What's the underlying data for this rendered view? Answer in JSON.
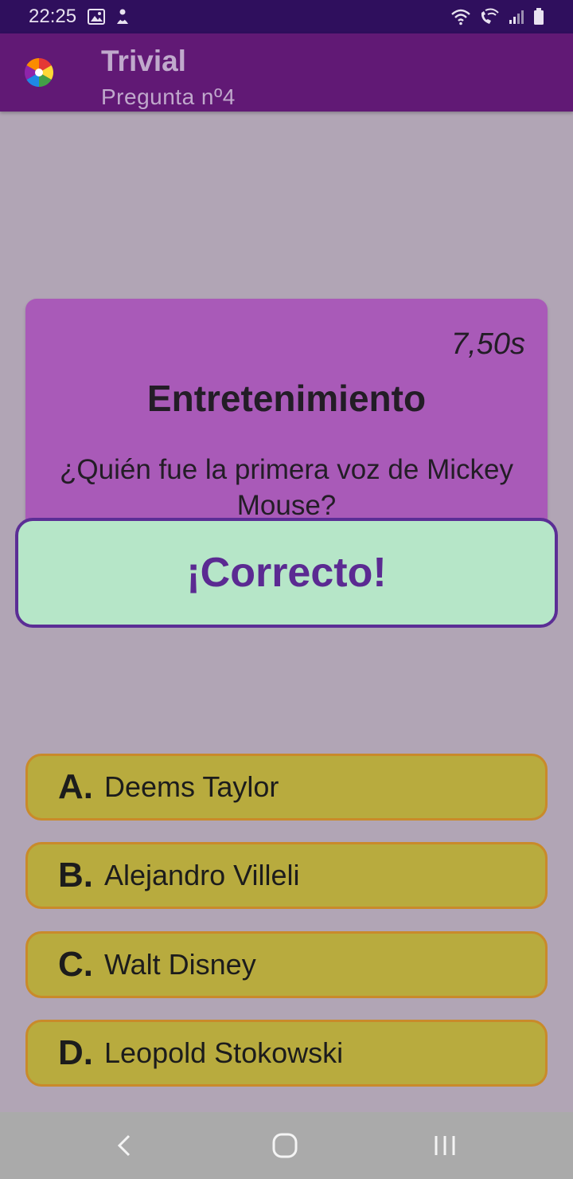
{
  "status_bar": {
    "time": "22:25",
    "left_icons": [
      "image-icon",
      "notification-icon"
    ],
    "right_icons": [
      "wifi-icon",
      "wifi-call-icon",
      "signal-icon",
      "battery-icon"
    ]
  },
  "app_bar": {
    "title": "Trivial",
    "subtitle": "Pregunta nº4",
    "logo_colors": [
      "#e53935",
      "#fdd835",
      "#43a047",
      "#1e88e5",
      "#8e24aa",
      "#fb8c00"
    ]
  },
  "question_card": {
    "timer": "7,50s",
    "category": "Entretenimiento",
    "question": "¿Quién fue la primera voz de Mickey Mouse?"
  },
  "feedback": {
    "text": "¡Correcto!"
  },
  "answers": [
    {
      "letter": "A.",
      "text": "Deems Taylor"
    },
    {
      "letter": "B.",
      "text": "Alejandro Villeli"
    },
    {
      "letter": "C.",
      "text": "Walt Disney"
    },
    {
      "letter": "D.",
      "text": "Leopold Stokowski"
    }
  ],
  "nav_bar": {
    "buttons": [
      "back-icon",
      "home-icon",
      "recents-icon"
    ]
  },
  "colors": {
    "status_bar": "#2f0f5d",
    "app_bar": "#611975",
    "background": "#b1a5b5",
    "card": "#a95ab8",
    "feedback_bg": "#b6e6c8",
    "feedback_border": "#5b2e95",
    "answer_bg": "#b8ab3e",
    "answer_border": "#c98a2a"
  }
}
